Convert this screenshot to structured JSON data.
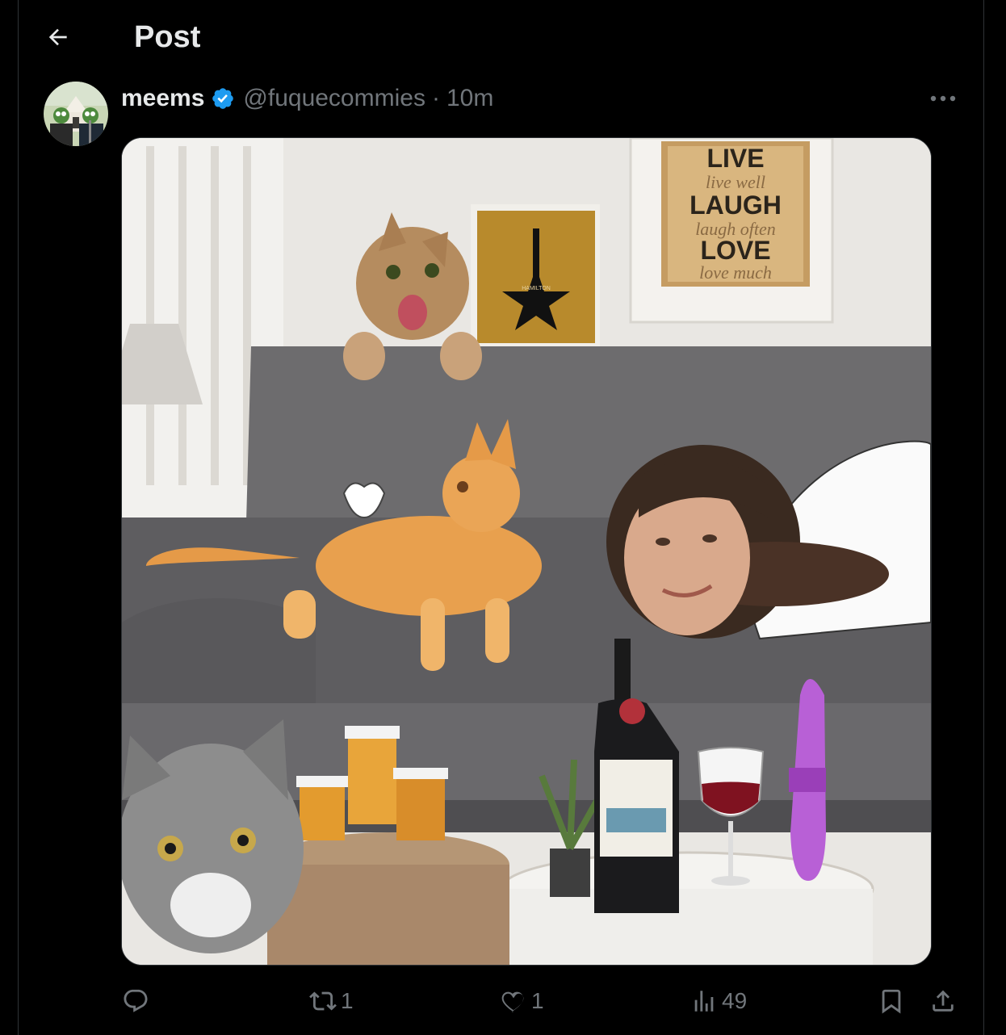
{
  "header": {
    "title": "Post",
    "back_icon": "arrow-left-icon"
  },
  "post": {
    "author_name": "meems",
    "verified": true,
    "handle": "@fuquecommies",
    "separator": "·",
    "time": "10m",
    "media": {
      "poster_lines": [
        "LIVE",
        "live well",
        "LAUGH",
        "laugh often",
        "LOVE",
        "love much"
      ],
      "album_text": "HAMILTON"
    }
  },
  "actions": {
    "reply": {
      "icon": "reply-icon",
      "count": ""
    },
    "repost": {
      "icon": "repost-icon",
      "count": "1"
    },
    "like": {
      "icon": "heart-icon",
      "count": "1"
    },
    "views": {
      "icon": "views-icon",
      "count": "49"
    },
    "bookmark": {
      "icon": "bookmark-icon"
    },
    "share": {
      "icon": "share-icon"
    }
  },
  "colors": {
    "background": "#000000",
    "text": "#e7e9ea",
    "muted": "#71767b",
    "verified": "#1d9bf0",
    "border": "#2f3336"
  }
}
